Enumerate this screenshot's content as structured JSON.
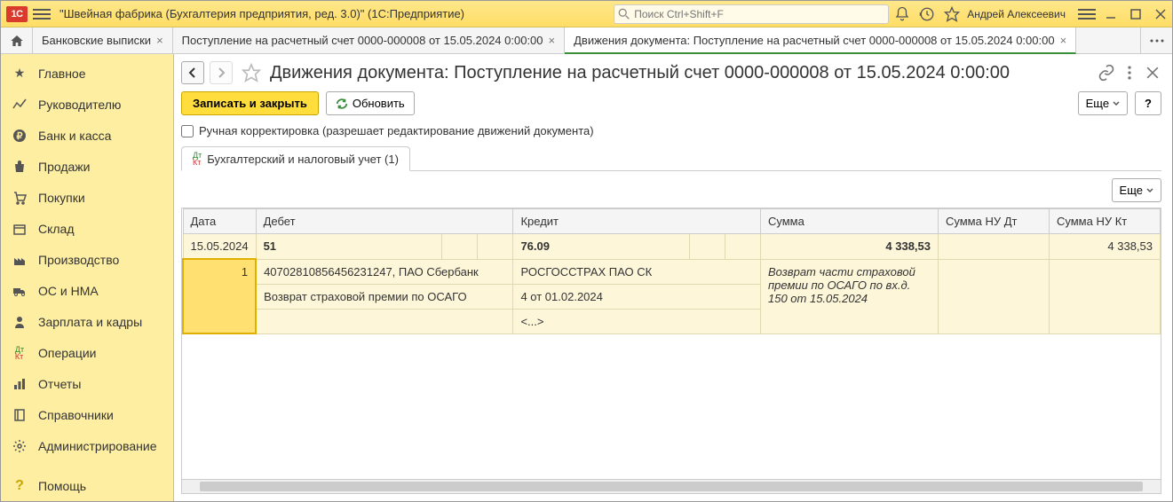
{
  "titlebar": {
    "app_title": "\"Швейная фабрика (Бухгалтерия предприятия, ред. 3.0)\"  (1С:Предприятие)",
    "search_placeholder": "Поиск Ctrl+Shift+F",
    "user": "Андрей Алексеевич"
  },
  "tabs": [
    {
      "label": "Банковские выписки",
      "active": false
    },
    {
      "label": "Поступление на расчетный счет 0000-000008 от 15.05.2024 0:00:00",
      "active": false
    },
    {
      "label": "Движения документа: Поступление на расчетный счет 0000-000008 от 15.05.2024 0:00:00",
      "active": true
    }
  ],
  "sidebar": {
    "items": [
      "Главное",
      "Руководителю",
      "Банк и касса",
      "Продажи",
      "Покупки",
      "Склад",
      "Производство",
      "ОС и НМА",
      "Зарплата и кадры",
      "Операции",
      "Отчеты",
      "Справочники",
      "Администрирование",
      "Помощь"
    ]
  },
  "doc": {
    "title": "Движения документа: Поступление на расчетный счет 0000-000008 от 15.05.2024 0:00:00",
    "save_close": "Записать и закрыть",
    "refresh": "Обновить",
    "more": "Еще",
    "help": "?",
    "checkbox_label": "Ручная корректировка (разрешает редактирование движений документа)",
    "inner_tab": "Бухгалтерский и налоговый учет (1)"
  },
  "table": {
    "headers": {
      "date": "Дата",
      "debit": "Дебет",
      "credit": "Кредит",
      "sum": "Сумма",
      "nu_dt": "Сумма НУ Дт",
      "nu_kt": "Сумма НУ Кт"
    },
    "row1": {
      "date": "15.05.2024",
      "num": "1",
      "debit_acc": "51",
      "credit_acc": "76.09",
      "sum": "4 338,53",
      "nu_kt": "4 338,53"
    },
    "row2": {
      "debit_detail": "40702810856456231247, ПАО Сбербанк",
      "credit_detail": "РОСГОССТРАХ ПАО СК",
      "sum_desc": "Возврат части страховой премии по ОСАГО по вх.д. 150 от 15.05.2024"
    },
    "row3": {
      "debit_detail": "Возврат страховой премии по ОСАГО",
      "credit_detail": "4 от 01.02.2024"
    },
    "row4": {
      "credit_detail": "<...>"
    }
  }
}
